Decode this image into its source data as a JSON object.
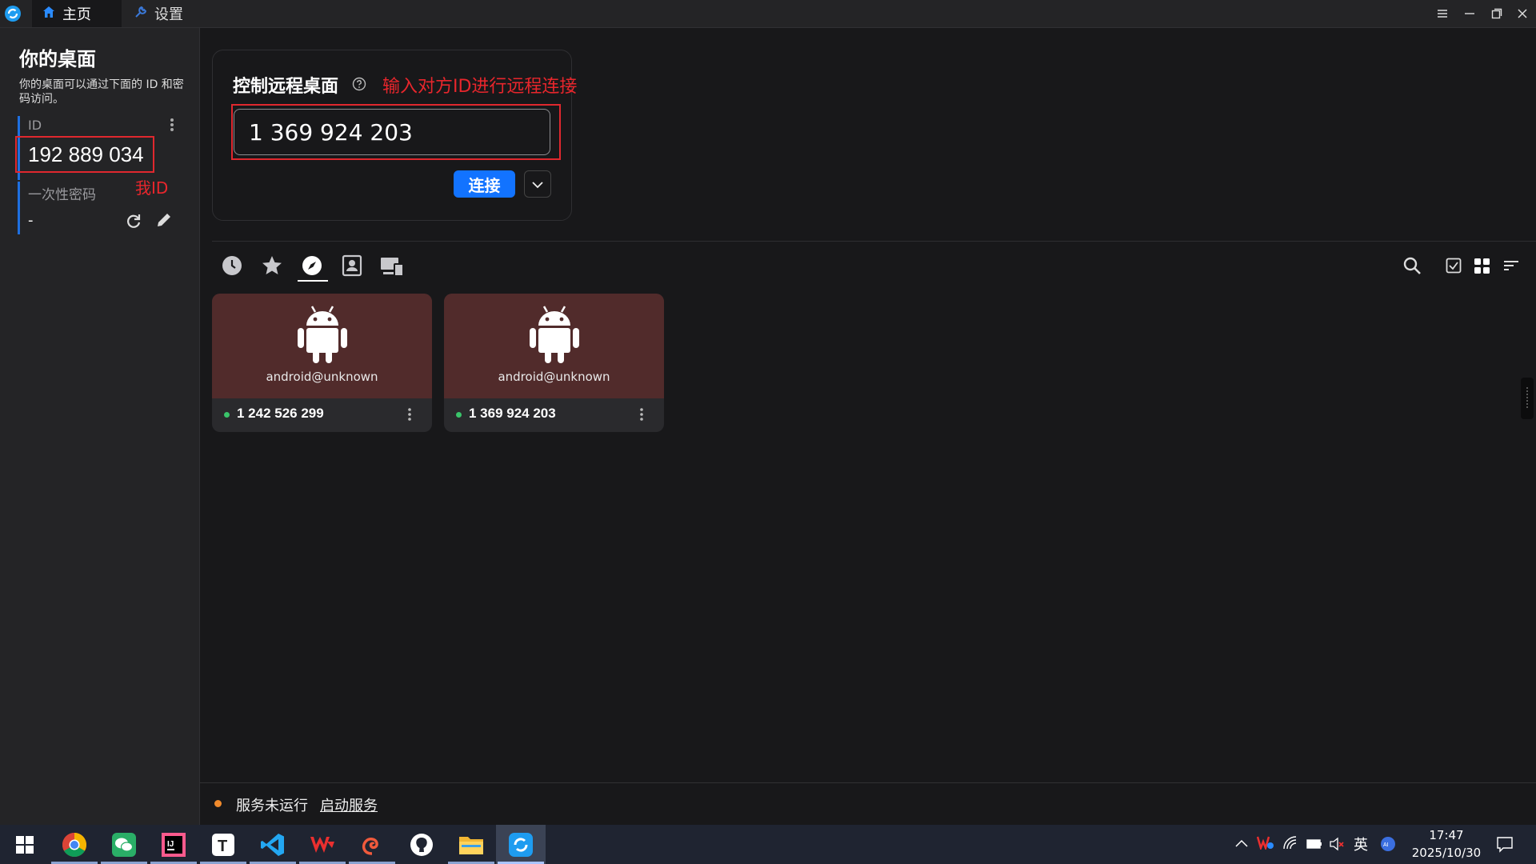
{
  "titlebar": {
    "tabs": [
      {
        "label": "主页",
        "icon": "home-icon"
      },
      {
        "label": "设置",
        "icon": "wrench-icon"
      }
    ],
    "window_controls": [
      "menu-icon",
      "minimize-icon",
      "restore-icon",
      "close-icon"
    ]
  },
  "sidebar": {
    "title": "你的桌面",
    "description": "你的桌面可以通过下面的 ID 和密码访问。",
    "id_label": "ID",
    "id_value": "192 889 034",
    "password_label": "一次性密码",
    "password_value": "-",
    "annotation": "我ID"
  },
  "connect": {
    "title": "控制远程桌面",
    "annotation": "输入对方ID进行远程连接",
    "input_value": "1 369 924 203",
    "button_label": "连接"
  },
  "peer_tabs": [
    "recent-icon",
    "favorites-icon",
    "discovered-icon",
    "address-book-icon",
    "group-icon"
  ],
  "peer_tab_selected": "discovered-icon",
  "toolbar_icons": [
    "search-icon",
    "select-icon",
    "grid-view-icon",
    "sort-icon"
  ],
  "peers": [
    {
      "name": "android@unknown",
      "id": "1 242 526 299",
      "status": "online"
    },
    {
      "name": "android@unknown",
      "id": "1 369 924 203",
      "status": "online"
    }
  ],
  "status": {
    "text": "服务未运行",
    "link": "启动服务",
    "color": "#f08a2c"
  },
  "taskbar": {
    "apps": [
      "windows-start-icon",
      "chrome-icon",
      "wechat-icon",
      "intellij-icon",
      "typora-icon",
      "vscode-icon",
      "wps-icon",
      "swirl-app-icon",
      "github-icon",
      "file-explorer-icon",
      "rustdesk-icon"
    ],
    "ime": "英",
    "time": "17:47",
    "date": "2025/10/30"
  },
  "colors": {
    "accent": "#1273ff",
    "annotation_red": "#e8262c",
    "peer_card": "#512b2b"
  }
}
